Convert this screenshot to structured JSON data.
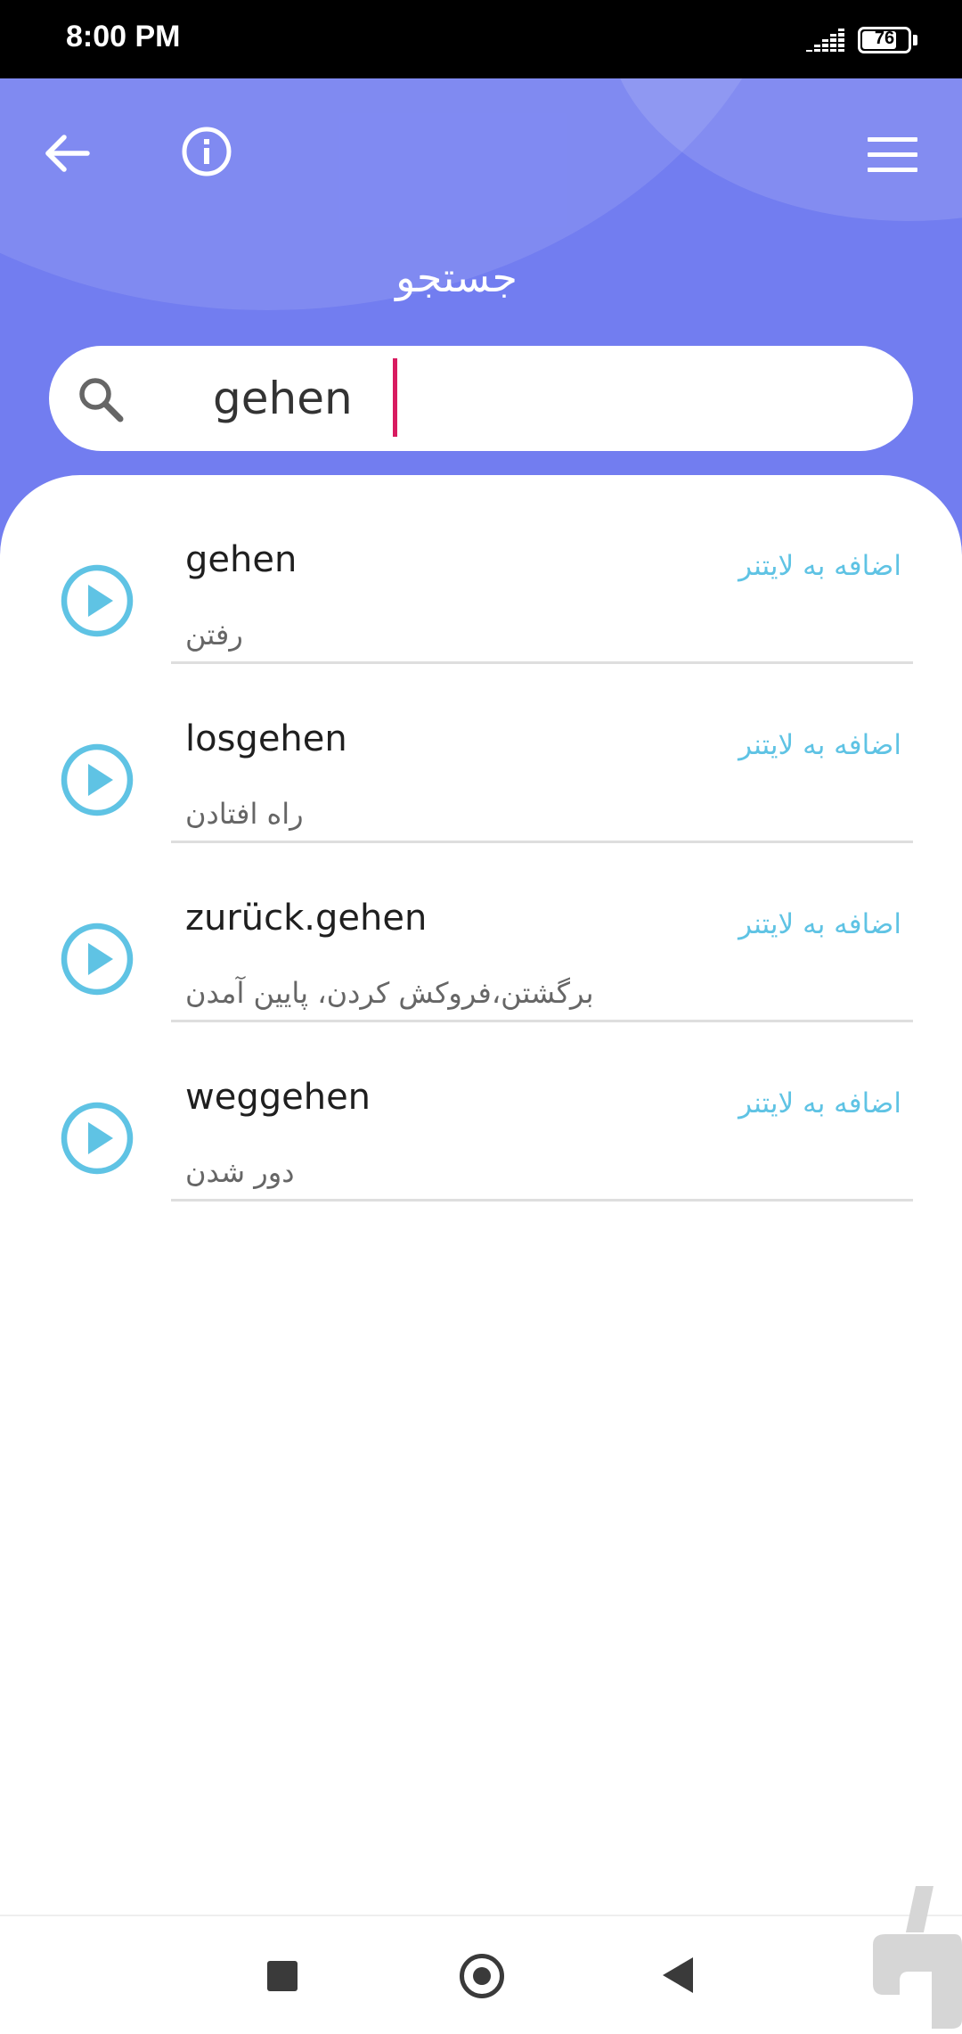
{
  "status_bar": {
    "time": "8:00 PM",
    "battery": "76",
    "battery_level": 0.76
  },
  "header": {
    "title": "جستجو",
    "back_icon": "arrow-left-icon",
    "info_icon": "info-circle-icon",
    "menu_icon": "hamburger-menu-icon"
  },
  "search": {
    "value": "gehen",
    "icon": "search-icon"
  },
  "results": [
    {
      "word": "gehen",
      "translation": "رفتن",
      "action": "اضافه به لایتنر"
    },
    {
      "word": "losgehen",
      "translation": "راه افتادن",
      "action": "اضافه به لایتنر"
    },
    {
      "word": "zurück.gehen",
      "translation": "برگشتن،فروکش کردن، پایین آمدن",
      "action": "اضافه به لایتنر"
    },
    {
      "word": "weggehen",
      "translation": "دور شدن",
      "action": "اضافه به لایتنر"
    }
  ],
  "colors": {
    "header": "#727df0",
    "accent": "#5fc3e4",
    "caret": "#d81b60"
  }
}
